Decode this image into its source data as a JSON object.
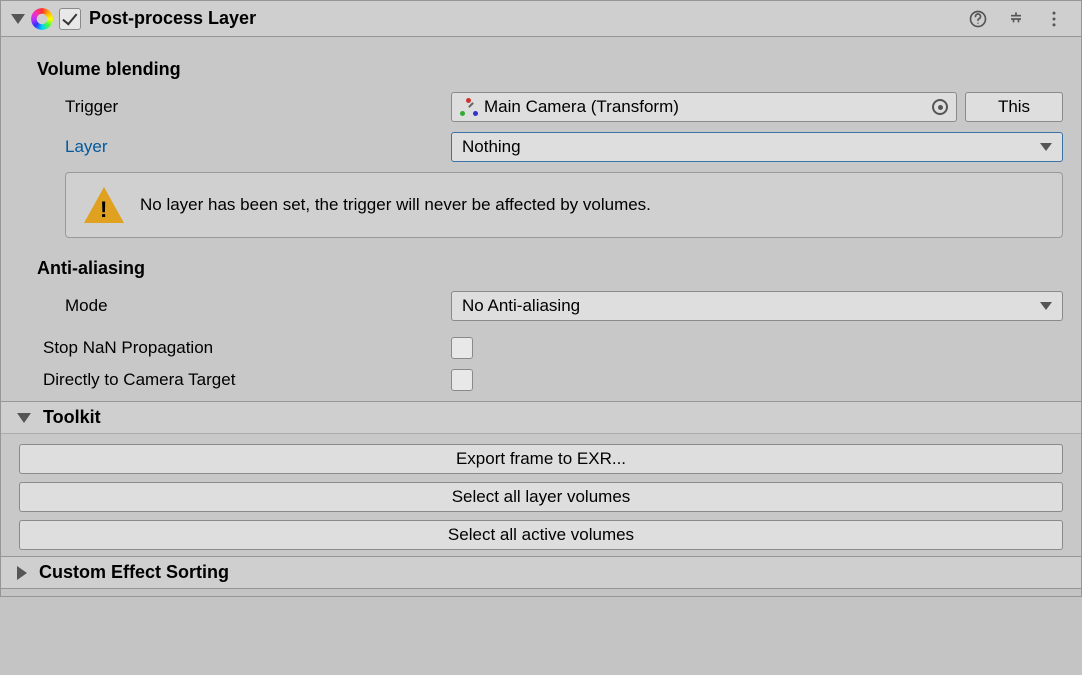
{
  "header": {
    "title": "Post-process Layer",
    "enabled": true
  },
  "volume_blending": {
    "section_title": "Volume blending",
    "trigger_label": "Trigger",
    "trigger_value": "Main Camera (Transform)",
    "this_button": "This",
    "layer_label": "Layer",
    "layer_value": "Nothing",
    "warning": "No layer has been set, the trigger will never be affected by volumes."
  },
  "anti_aliasing": {
    "section_title": "Anti-aliasing",
    "mode_label": "Mode",
    "mode_value": "No Anti-aliasing"
  },
  "stop_nan": {
    "label": "Stop NaN Propagation",
    "checked": false
  },
  "direct_camera": {
    "label": "Directly to Camera Target",
    "checked": false
  },
  "toolkit": {
    "title": "Toolkit",
    "export_btn": "Export frame to EXR...",
    "select_layer_btn": "Select all layer volumes",
    "select_active_btn": "Select all active volumes"
  },
  "custom_effect_sorting": {
    "title": "Custom Effect Sorting"
  }
}
